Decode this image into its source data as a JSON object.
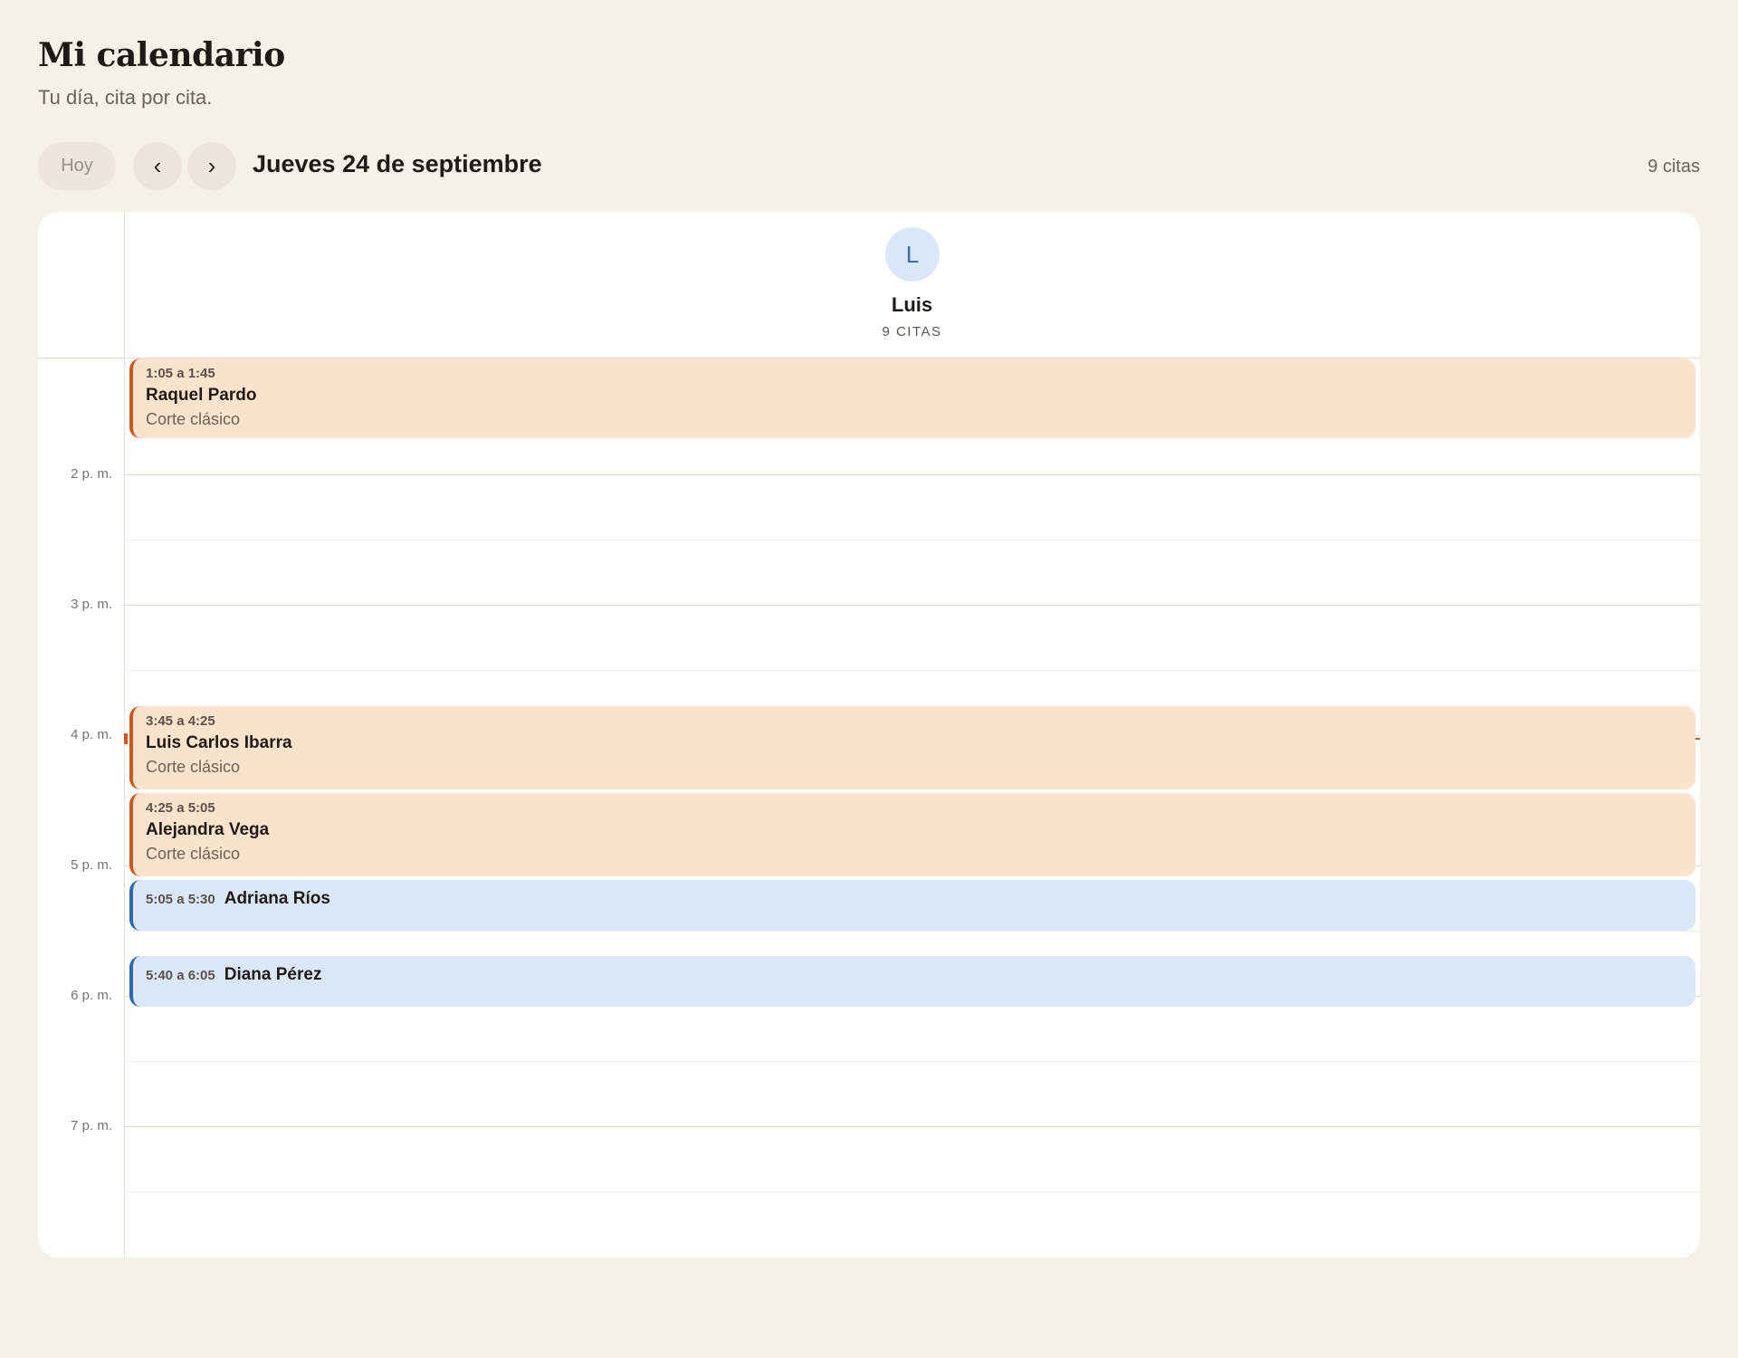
{
  "header": {
    "title": "Mi calendario",
    "subtitle": "Tu día, cita por cita."
  },
  "toolbar": {
    "today_label": "Hoy",
    "prev_icon": "chevron-left-icon",
    "next_icon": "chevron-right-icon",
    "prev_glyph": "‹",
    "next_glyph": "›",
    "date": "Jueves 24 de septiembre",
    "appointment_count": "9 citas"
  },
  "staff": {
    "initial": "L",
    "name": "Luis",
    "count": "9 CITAS"
  },
  "hours": [
    "2 p. m.",
    "3 p. m.",
    "4 p. m.",
    "5 p. m.",
    "6 p. m.",
    "7 p. m."
  ],
  "appointments": [
    {
      "time": "1:05 a 1:45",
      "client": "Raquel Pardo",
      "service": "Corte clásico",
      "color": "#c8591f"
    },
    {
      "time": "3:45 a 4:25",
      "client": "Luis Carlos Ibarra",
      "service": "Corte clásico",
      "color": "#c8591f"
    },
    {
      "time": "4:25 a 5:05",
      "client": "Alejandra Vega",
      "service": "Corte clásico",
      "color": "#c8591f"
    },
    {
      "time": "5:05 a 5:30",
      "client": "Adriana Ríos",
      "service": "",
      "color": "#3068b0"
    },
    {
      "time": "5:40 a 6:05",
      "client": "Diana Pérez",
      "service": "",
      "color": "#3068b0"
    }
  ],
  "colors": {
    "background": "#f6f1e7",
    "card": "#ffffff",
    "orange_fill": "#fbe2cd",
    "blue_fill": "#dbe7f8",
    "accent": "#c8591f"
  }
}
